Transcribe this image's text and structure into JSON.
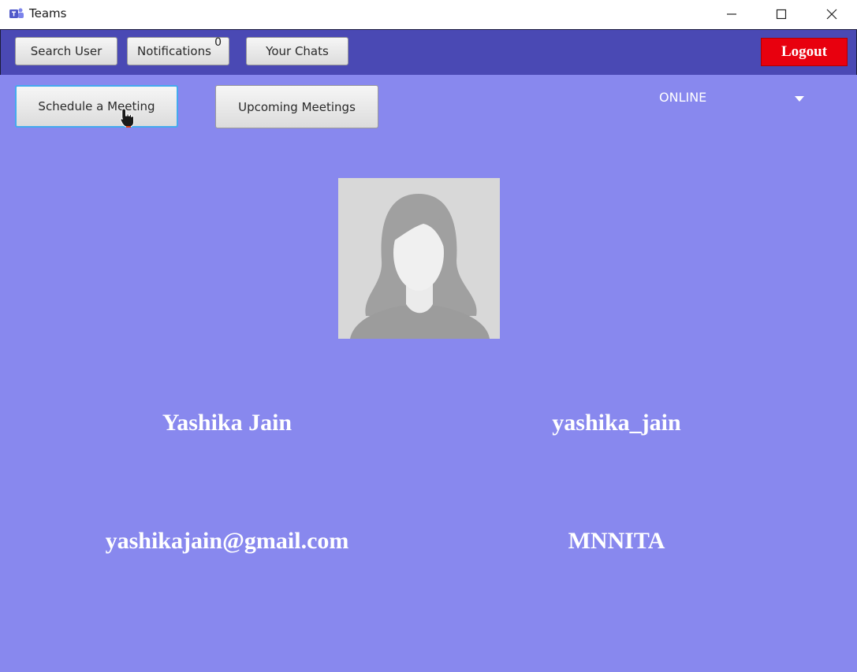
{
  "window": {
    "title": "Teams",
    "icon": "teams-app-icon",
    "controls": [
      "minimize-icon",
      "maximize-icon",
      "close-icon"
    ]
  },
  "toolbar": {
    "search_label": "Search User",
    "notifications_label": "Notifications",
    "notifications_count": "0",
    "chats_label": "Your Chats",
    "logout_label": "Logout"
  },
  "actions": {
    "schedule_label": "Schedule a Meeting",
    "upcoming_label": "Upcoming Meetings"
  },
  "status": {
    "selected": "ONLINE"
  },
  "profile": {
    "avatar": "default-female-avatar",
    "full_name": "Yashika Jain",
    "username": "yashika_jain",
    "email": "yashikajain@gmail.com",
    "organization": "MNNITA"
  },
  "colors": {
    "toolbar_bg": "#4a49b4",
    "main_bg": "#8888ee",
    "logout_bg": "#e8000e",
    "focus_ring": "#44aaee"
  }
}
